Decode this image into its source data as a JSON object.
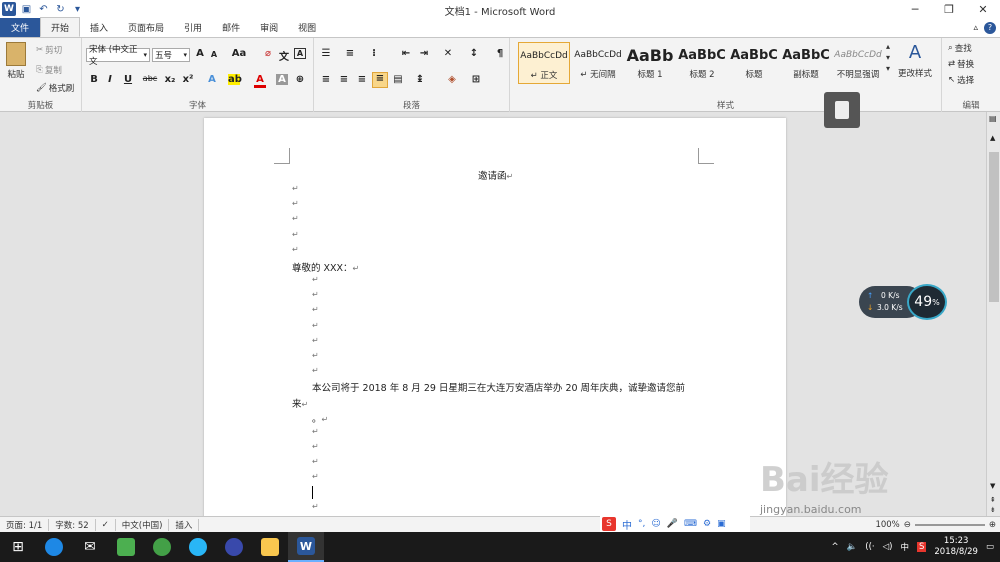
{
  "window": {
    "title": "文档1 - Microsoft Word"
  },
  "tabs": [
    "文件",
    "开始",
    "插入",
    "页面布局",
    "引用",
    "邮件",
    "审阅",
    "视图"
  ],
  "clipboard": {
    "paste": "粘贴",
    "cut": "剪切",
    "copy": "复制",
    "format_painter": "格式刷",
    "label": "剪贴板"
  },
  "font": {
    "name": "宋体 (中文正文",
    "size": "五号",
    "label": "字体",
    "grow": "A",
    "shrink": "A",
    "case": "Aa",
    "bold": "B",
    "italic": "I",
    "underline": "U",
    "strike": "abc",
    "sub": "x₂",
    "sup": "x²"
  },
  "paragraph": {
    "label": "段落"
  },
  "styles": {
    "label": "样式",
    "items": [
      {
        "preview": "AaBbCcDd",
        "name": "↵ 正文"
      },
      {
        "preview": "AaBbCcDd",
        "name": "↵ 无间隔"
      },
      {
        "preview": "AaBb",
        "name": "标题 1"
      },
      {
        "preview": "AaBbC",
        "name": "标题 2"
      },
      {
        "preview": "AaBbC",
        "name": "标题"
      },
      {
        "preview": "AaBbC",
        "name": "副标题"
      },
      {
        "preview": "AaBbCcDd",
        "name": "不明显强调"
      }
    ],
    "change": "更改样式"
  },
  "editing": {
    "find": "查找",
    "replace": "替换",
    "select": "选择",
    "label": "编辑"
  },
  "document": {
    "title": "邀请函",
    "salutation": "尊敬的 XXX：",
    "body_line1": "本公司将于 2018 年 8 月 29 日星期三在大连万安酒店举办 20 周年庆典，诚挚邀请您前",
    "body_line2": "来",
    "punct": "。"
  },
  "status": {
    "page": "页面: 1/1",
    "words": "字数: 52",
    "lang": "中文(中国)",
    "mode": "插入",
    "zoom": "100%"
  },
  "network": {
    "up": "0 K/s",
    "down": "3.0 K/s",
    "percent": "49"
  },
  "taskbar": {
    "time": "15:23",
    "date": "2018/8/29",
    "ime": "中"
  },
  "watermark": {
    "text": "Bai经验",
    "url": "jingyan.baidu.com"
  }
}
